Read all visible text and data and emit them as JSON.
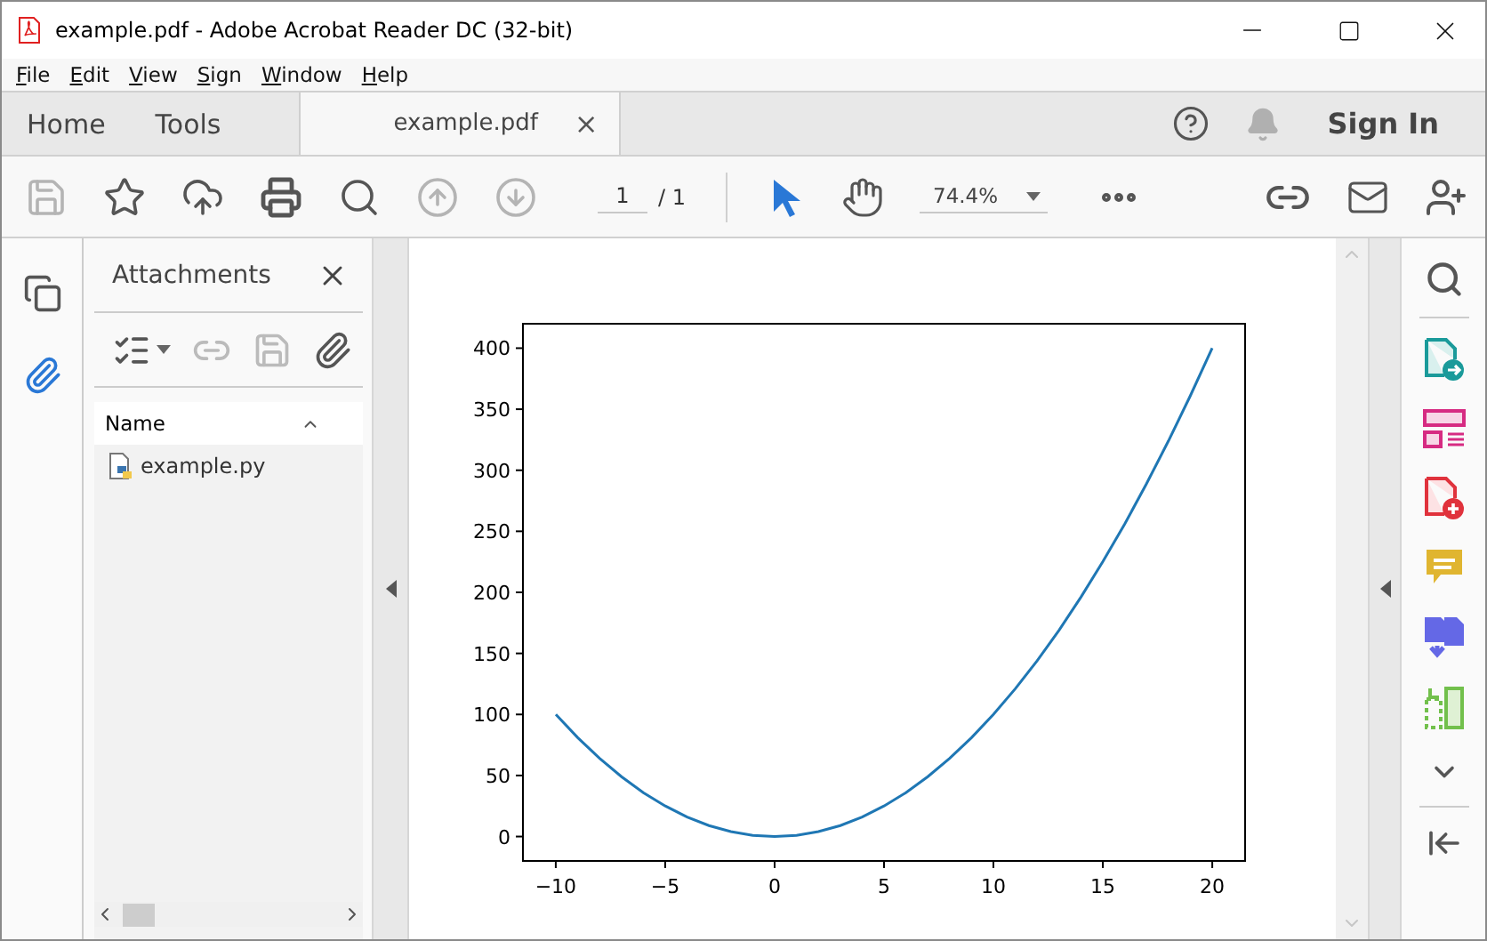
{
  "window": {
    "title": "example.pdf - Adobe Acrobat Reader DC (32-bit)"
  },
  "menu": [
    "File",
    "Edit",
    "View",
    "Sign",
    "Window",
    "Help"
  ],
  "tabs": [
    {
      "label": "Home",
      "kind": "nav",
      "selected": false
    },
    {
      "label": "Tools",
      "kind": "nav",
      "selected": false
    },
    {
      "label": "example.pdf",
      "kind": "document",
      "selected": true,
      "close": "×"
    }
  ],
  "header": {
    "sign_in": "Sign In"
  },
  "toolbar": {
    "tools": [
      {
        "kind": "save",
        "disabled": true
      },
      {
        "kind": "bookmark",
        "disabled": false
      },
      {
        "kind": "upload",
        "disabled": false
      },
      {
        "kind": "print",
        "disabled": false
      },
      {
        "kind": "find",
        "disabled": false
      },
      {
        "kind": "previous-page",
        "disabled": true
      },
      {
        "kind": "next-page",
        "disabled": true
      }
    ],
    "page": {
      "current": "1",
      "total": "/ 1"
    },
    "pointer_tools": [
      {
        "kind": "select",
        "selected": true
      },
      {
        "kind": "hand",
        "selected": false
      }
    ],
    "zoom": "74.4%"
  },
  "left_rail": [
    {
      "kind": "pages",
      "selected": false
    },
    {
      "kind": "attachments",
      "selected": true
    }
  ],
  "attachments": {
    "title": "Attachments",
    "tools": [
      {
        "kind": "view-options",
        "disabled": false
      },
      {
        "kind": "add-file",
        "disabled": true
      },
      {
        "kind": "save",
        "disabled": true
      },
      {
        "kind": "open",
        "disabled": false
      }
    ],
    "column": "Name",
    "files": [
      {
        "name": "example.py"
      }
    ]
  },
  "document": {
    "chart_data": {
      "type": "line",
      "x": [
        -10,
        -9,
        -8,
        -7,
        -6,
        -5,
        -4,
        -3,
        -2,
        -1,
        0,
        1,
        2,
        3,
        4,
        5,
        6,
        7,
        8,
        9,
        10,
        11,
        12,
        13,
        14,
        15,
        16,
        17,
        18,
        19,
        20
      ],
      "series": [
        {
          "color": "#1f77b4",
          "values": [
            100,
            81,
            64,
            49,
            36,
            25,
            16,
            9,
            4,
            1,
            0,
            1,
            4,
            9,
            16,
            25,
            36,
            49,
            64,
            81,
            100,
            121,
            144,
            169,
            196,
            225,
            256,
            289,
            324,
            361,
            400
          ]
        }
      ],
      "xlim": [
        -11.5,
        21.5
      ],
      "ylim": [
        -20,
        420
      ],
      "xticks": [
        {
          "value": -10,
          "label": "−10"
        },
        {
          "value": -5,
          "label": "−5"
        },
        0,
        5,
        10,
        15,
        20
      ],
      "yticks": [
        0,
        50,
        100,
        150,
        200,
        250,
        300,
        350,
        400
      ]
    }
  }
}
